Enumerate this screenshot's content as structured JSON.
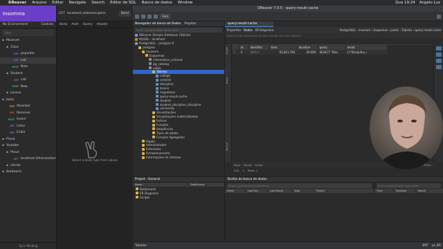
{
  "menubar": {
    "apple": "",
    "app": "DBeaver",
    "items": [
      "Arquivo",
      "Editar",
      "Navigate",
      "Search",
      "Editor de SQL",
      "Banco de dados",
      "Window"
    ],
    "clock": "Qua 19:24",
    "user": "Angelo Luz"
  },
  "insomnia": {
    "workspace": "Insomnia",
    "env": "No Environment",
    "cookies": "Cookies",
    "filter_placeholder": "Filter",
    "tree": [
      {
        "type": "folder",
        "label": "Museum",
        "depth": 0
      },
      {
        "type": "folder",
        "label": "Class",
        "depth": 1
      },
      {
        "type": "req",
        "method": "GET",
        "label": "populate",
        "depth": 2
      },
      {
        "type": "req",
        "method": "GET",
        "label": "List",
        "depth": 2,
        "selected": true
      },
      {
        "type": "req",
        "method": "POST",
        "label": "New",
        "depth": 2
      },
      {
        "type": "folder",
        "label": "Student",
        "depth": 1
      },
      {
        "type": "req",
        "method": "GET",
        "label": "List",
        "depth": 2
      },
      {
        "type": "req",
        "method": "POST",
        "label": "New",
        "depth": 2
      },
      {
        "type": "folder",
        "label": "Lesson",
        "depth": 1
      },
      {
        "type": "folder",
        "label": "basic",
        "depth": 0
      },
      {
        "type": "req",
        "method": "PUT",
        "label": "Atualizar",
        "depth": 1
      },
      {
        "type": "req",
        "method": "DEL",
        "label": "Remover",
        "depth": 1
      },
      {
        "type": "req",
        "method": "POST",
        "label": "Inserir",
        "depth": 1
      },
      {
        "type": "req",
        "method": "GET",
        "label": "Listar",
        "depth": 1
      },
      {
        "type": "req",
        "method": "GET",
        "label": "Exibir",
        "depth": 1
      },
      {
        "type": "folder",
        "label": "Prova",
        "depth": 0
      },
      {
        "type": "folder",
        "label": "Youtube",
        "depth": 0
      },
      {
        "type": "folder",
        "label": "Prova",
        "depth": 1
      },
      {
        "type": "req",
        "method": "GET",
        "label": "localhost:3/transaction",
        "depth": 2
      },
      {
        "type": "folder",
        "label": "clients",
        "depth": 1
      },
      {
        "type": "folder",
        "label": "Barbearia",
        "depth": 0
      }
    ],
    "footer": "Sync Pending",
    "method": "GET",
    "url": "localhost:3000/discipline",
    "send": "Send",
    "tabs": [
      "Body",
      "Auth",
      "Query",
      "Header"
    ],
    "hint": "Select a body type from above"
  },
  "dbeaver": {
    "title": "DBeaver 7.0.5 - query-result-cache",
    "combo": "Auto",
    "nav_tabs": [
      "Navegador de banco de Dados",
      "Projetos"
    ],
    "nav_filter": "Enter a part of table name here",
    "nav_tree": [
      {
        "label": "DBeaver Sample Database (SQLite)",
        "d": 0,
        "c": "#6aa1d8"
      },
      {
        "label": "MySQL - localhost",
        "d": 0,
        "c": "#d28a3a"
      },
      {
        "label": "PostgreSQL - postgres 6",
        "d": 0,
        "c": "#6aa1d8"
      },
      {
        "label": "postgres",
        "d": 1,
        "c": "#d7b24c"
      },
      {
        "label": "museum",
        "d": 2,
        "c": "#d7b24c"
      },
      {
        "label": "Esquemas",
        "d": 3,
        "c": "#d7b24c"
      },
      {
        "label": "information_schema",
        "d": 4,
        "c": "#8f8f8f"
      },
      {
        "label": "pg_catalog",
        "d": 4,
        "c": "#8f8f8f"
      },
      {
        "label": "public",
        "d": 4,
        "c": "#8f8f8f"
      },
      {
        "label": "Tabelas",
        "d": 5,
        "c": "#d7b24c",
        "sel": true
      },
      {
        "label": "college",
        "d": 6,
        "c": "#5f95c7"
      },
      {
        "label": "content",
        "d": 6,
        "c": "#5f95c7"
      },
      {
        "label": "discipline",
        "d": 6,
        "c": "#5f95c7"
      },
      {
        "label": "lesson",
        "d": 6,
        "c": "#5f95c7"
      },
      {
        "label": "migrations",
        "d": 6,
        "c": "#5f95c7"
      },
      {
        "label": "query-result-cache",
        "d": 6,
        "c": "#5f95c7"
      },
      {
        "label": "student",
        "d": 6,
        "c": "#5f95c7"
      },
      {
        "label": "student_discipline_discipline",
        "d": 6,
        "c": "#5f95c7"
      },
      {
        "label": "university",
        "d": 6,
        "c": "#5f95c7"
      },
      {
        "label": "Visualizações",
        "d": 5,
        "c": "#d7b24c"
      },
      {
        "label": "Visualizações materializadas",
        "d": 5,
        "c": "#d7b24c"
      },
      {
        "label": "Índices",
        "d": 5,
        "c": "#d7b24c"
      },
      {
        "label": "Funções",
        "d": 5,
        "c": "#d7b24c"
      },
      {
        "label": "Sequências",
        "d": 5,
        "c": "#d7b24c"
      },
      {
        "label": "Tipos de dados",
        "d": 5,
        "c": "#d7b24c"
      },
      {
        "label": "Funções Agregadas",
        "d": 5,
        "c": "#d7b24c"
      },
      {
        "label": "Papéis",
        "d": 2,
        "c": "#d7b24c"
      },
      {
        "label": "Administrador",
        "d": 2,
        "c": "#d7b24c"
      },
      {
        "label": "Extensões",
        "d": 2,
        "c": "#d7b24c"
      },
      {
        "label": "Armazenamento",
        "d": 2,
        "c": "#d7b24c"
      },
      {
        "label": "Informações do sistema",
        "d": 2,
        "c": "#d7b24c"
      }
    ],
    "editor_tab": "query-result-cache",
    "subtabs": [
      "Properties",
      "Dados",
      "ER Diagrama"
    ],
    "crumbs": [
      "PostgreSQL",
      "museum",
      "Esquemas",
      "public",
      "Tabelas",
      "query-result-cache"
    ],
    "filter_placeholder": "Enter a SQL expression to filter results (use Ctrl+Space)",
    "vtabs": [
      "Grade",
      "Texto",
      "Record"
    ],
    "columns": [
      "",
      "id",
      "identifier",
      "time",
      "duration",
      "query",
      "result"
    ],
    "rows": [
      [
        "1",
        "3",
        "[NULL]",
        "61,811,782",
        "20.000",
        "SELECT \"Disc",
        "[{\"Discipline_i"
      ]
    ],
    "grid_status": {
      "save": "Save",
      "cancel": "Cancel",
      "script": "Script",
      "fetched": "1 row(s) fetched - 33ms"
    },
    "grid_status2": {
      "limit": "200",
      "rows": "1",
      "label": "Rows: 1"
    },
    "project_title": "Project - General",
    "project_cols": [
      "Name",
      "DataSource"
    ],
    "project_rows": [
      "Bookmarks",
      "ER Diagrams",
      "Scripts"
    ],
    "tasks_title": "Tarefas de banco de dados",
    "tasks_filter": "Enter a part of task name here",
    "tasks_cols": [
      "Name",
      "Last Run",
      "Last Result",
      "Type",
      "Project"
    ],
    "tasks_cols2": [
      "Time",
      "Duration",
      "Result"
    ],
    "status": {
      "left": "Tabelas",
      "right": [
        "BRT",
        "pt_BR"
      ]
    }
  }
}
